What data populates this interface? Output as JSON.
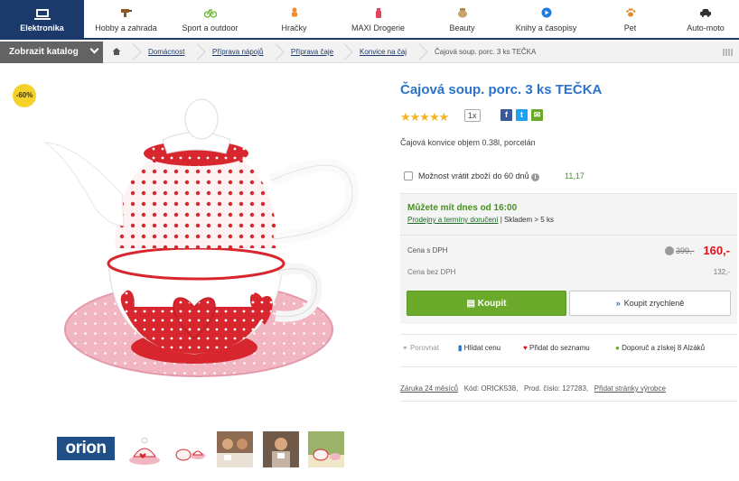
{
  "nav": {
    "items": [
      {
        "label": "Elektronika",
        "icon": "laptop-icon"
      },
      {
        "label": "Hobby a zahrada",
        "icon": "drill-icon"
      },
      {
        "label": "Sport a outdoor",
        "icon": "bicycle-icon"
      },
      {
        "label": "Hračky",
        "icon": "toy-icon"
      },
      {
        "label": "MAXI Drogerie",
        "icon": "spray-icon"
      },
      {
        "label": "Beauty",
        "icon": "jar-icon"
      },
      {
        "label": "Knihy a časopisy",
        "icon": "play-icon"
      },
      {
        "label": "Pet",
        "icon": "paw-icon"
      },
      {
        "label": "Auto-moto",
        "icon": "car-icon"
      }
    ]
  },
  "breadcrumb": {
    "catalog_label": "Zobrazit katalog",
    "items": [
      "Domácnost",
      "Příprava nápojů",
      "Příprava čaje",
      "Konvice na čaj"
    ],
    "current": "Čajová soup. porc. 3 ks TEČKA"
  },
  "product": {
    "discount_badge": "-60%",
    "title": "Čajová soup. porc. 3 ks TEČKA",
    "rating": 5,
    "stars": "★★★★★",
    "rating_count": "1x",
    "description": "Čajová konvice objem 0.38l, porcelán",
    "return_label": "Možnost vrátit zboží do 60 dnů",
    "return_price": "11,17",
    "availability": "Můžete mít dnes od 16:00",
    "availability_link": "Prodejny a termíny doručení",
    "stock": "| Skladem > 5 ks",
    "price_label": "Cena s DPH",
    "price_old": "399,-",
    "price": "160,-",
    "price_novat_label": "Cena bez DPH",
    "price_novat": "132,-",
    "buy_label": "Koupit",
    "buy_fast_label": "Koupit zrychleně",
    "brand": "orion"
  },
  "actions": {
    "compare": "Porovnat",
    "watch": "Hlídat cenu",
    "wishlist": "Přidat do seznamu",
    "recommend": "Doporuč a získej 8 Alzáků"
  },
  "meta": {
    "warranty": "Záruka 24 měsíců",
    "code": "Kód: ORICK538,",
    "prodno": "Prod. číslo: 127283,",
    "vendor_link": "Přidat stránky výrobce"
  },
  "social": {
    "facebook": "f",
    "twitter": "t",
    "email": "✉"
  },
  "colors": {
    "brand_navy": "#1b3a6b",
    "title_blue": "#2b73c8",
    "price_red": "#e0101a",
    "buy_green": "#6ba92b",
    "badge_yellow": "#f5d22a"
  }
}
